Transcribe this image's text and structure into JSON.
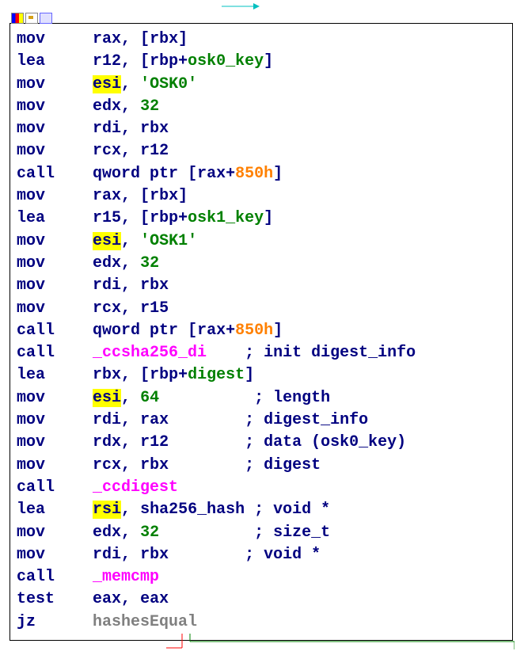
{
  "toolbar": {
    "icons": [
      "color-table-icon",
      "edit-icon",
      "graph-icon"
    ]
  },
  "lines": [
    {
      "m": "mov",
      "pad": "     ",
      "ops": [
        {
          "t": "reg",
          "v": "rax"
        },
        {
          "t": "punct",
          "v": ", ["
        },
        {
          "t": "reg",
          "v": "rbx"
        },
        {
          "t": "punct",
          "v": "]"
        }
      ]
    },
    {
      "m": "lea",
      "pad": "     ",
      "ops": [
        {
          "t": "reg",
          "v": "r12"
        },
        {
          "t": "punct",
          "v": ", ["
        },
        {
          "t": "reg",
          "v": "rbp"
        },
        {
          "t": "punct",
          "v": "+"
        },
        {
          "t": "symbol",
          "v": "osk0_key"
        },
        {
          "t": "punct",
          "v": "]"
        }
      ]
    },
    {
      "m": "mov",
      "pad": "     ",
      "ops": [
        {
          "t": "reg-hl",
          "v": "esi"
        },
        {
          "t": "punct",
          "v": ", "
        },
        {
          "t": "string",
          "v": "'OSK0'"
        }
      ]
    },
    {
      "m": "mov",
      "pad": "     ",
      "ops": [
        {
          "t": "reg",
          "v": "edx"
        },
        {
          "t": "punct",
          "v": ", "
        },
        {
          "t": "number",
          "v": "32"
        }
      ]
    },
    {
      "m": "mov",
      "pad": "     ",
      "ops": [
        {
          "t": "reg",
          "v": "rdi"
        },
        {
          "t": "punct",
          "v": ", "
        },
        {
          "t": "reg",
          "v": "rbx"
        }
      ]
    },
    {
      "m": "mov",
      "pad": "     ",
      "ops": [
        {
          "t": "reg",
          "v": "rcx"
        },
        {
          "t": "punct",
          "v": ", "
        },
        {
          "t": "reg",
          "v": "r12"
        }
      ]
    },
    {
      "m": "call",
      "pad": "    ",
      "ops": [
        {
          "t": "reg",
          "v": "qword ptr "
        },
        {
          "t": "punct",
          "v": "["
        },
        {
          "t": "reg",
          "v": "rax"
        },
        {
          "t": "punct",
          "v": "+"
        },
        {
          "t": "hex-offset",
          "v": "850h"
        },
        {
          "t": "punct",
          "v": "]"
        }
      ]
    },
    {
      "m": "mov",
      "pad": "     ",
      "ops": [
        {
          "t": "reg",
          "v": "rax"
        },
        {
          "t": "punct",
          "v": ", ["
        },
        {
          "t": "reg",
          "v": "rbx"
        },
        {
          "t": "punct",
          "v": "]"
        }
      ]
    },
    {
      "m": "lea",
      "pad": "     ",
      "ops": [
        {
          "t": "reg",
          "v": "r15"
        },
        {
          "t": "punct",
          "v": ", ["
        },
        {
          "t": "reg",
          "v": "rbp"
        },
        {
          "t": "punct",
          "v": "+"
        },
        {
          "t": "symbol",
          "v": "osk1_key"
        },
        {
          "t": "punct",
          "v": "]"
        }
      ]
    },
    {
      "m": "mov",
      "pad": "     ",
      "ops": [
        {
          "t": "reg-hl",
          "v": "esi"
        },
        {
          "t": "punct",
          "v": ", "
        },
        {
          "t": "string",
          "v": "'OSK1'"
        }
      ]
    },
    {
      "m": "mov",
      "pad": "     ",
      "ops": [
        {
          "t": "reg",
          "v": "edx"
        },
        {
          "t": "punct",
          "v": ", "
        },
        {
          "t": "number",
          "v": "32"
        }
      ]
    },
    {
      "m": "mov",
      "pad": "     ",
      "ops": [
        {
          "t": "reg",
          "v": "rdi"
        },
        {
          "t": "punct",
          "v": ", "
        },
        {
          "t": "reg",
          "v": "rbx"
        }
      ]
    },
    {
      "m": "mov",
      "pad": "     ",
      "ops": [
        {
          "t": "reg",
          "v": "rcx"
        },
        {
          "t": "punct",
          "v": ", "
        },
        {
          "t": "reg",
          "v": "r15"
        }
      ]
    },
    {
      "m": "call",
      "pad": "    ",
      "ops": [
        {
          "t": "reg",
          "v": "qword ptr "
        },
        {
          "t": "punct",
          "v": "["
        },
        {
          "t": "reg",
          "v": "rax"
        },
        {
          "t": "punct",
          "v": "+"
        },
        {
          "t": "hex-offset",
          "v": "850h"
        },
        {
          "t": "punct",
          "v": "]"
        }
      ]
    },
    {
      "m": "call",
      "pad": "    ",
      "ops": [
        {
          "t": "func-call",
          "v": "_ccsha256_di"
        },
        {
          "t": "comment",
          "v": "    ; init digest_info"
        }
      ]
    },
    {
      "m": "lea",
      "pad": "     ",
      "ops": [
        {
          "t": "reg",
          "v": "rbx"
        },
        {
          "t": "punct",
          "v": ", ["
        },
        {
          "t": "reg",
          "v": "rbp"
        },
        {
          "t": "punct",
          "v": "+"
        },
        {
          "t": "symbol",
          "v": "digest"
        },
        {
          "t": "punct",
          "v": "]"
        }
      ]
    },
    {
      "m": "mov",
      "pad": "     ",
      "ops": [
        {
          "t": "reg-hl",
          "v": "esi"
        },
        {
          "t": "punct",
          "v": ", "
        },
        {
          "t": "number",
          "v": "64"
        },
        {
          "t": "comment",
          "v": "          ; length"
        }
      ]
    },
    {
      "m": "mov",
      "pad": "     ",
      "ops": [
        {
          "t": "reg",
          "v": "rdi"
        },
        {
          "t": "punct",
          "v": ", "
        },
        {
          "t": "reg",
          "v": "rax"
        },
        {
          "t": "comment",
          "v": "        ; digest_info"
        }
      ]
    },
    {
      "m": "mov",
      "pad": "     ",
      "ops": [
        {
          "t": "reg",
          "v": "rdx"
        },
        {
          "t": "punct",
          "v": ", "
        },
        {
          "t": "reg",
          "v": "r12"
        },
        {
          "t": "comment",
          "v": "        ; data (osk0_key)"
        }
      ]
    },
    {
      "m": "mov",
      "pad": "     ",
      "ops": [
        {
          "t": "reg",
          "v": "rcx"
        },
        {
          "t": "punct",
          "v": ", "
        },
        {
          "t": "reg",
          "v": "rbx"
        },
        {
          "t": "comment",
          "v": "        ; digest"
        }
      ]
    },
    {
      "m": "call",
      "pad": "    ",
      "ops": [
        {
          "t": "func-call",
          "v": "_ccdigest"
        }
      ]
    },
    {
      "m": "lea",
      "pad": "     ",
      "ops": [
        {
          "t": "reg-hl",
          "v": "rsi"
        },
        {
          "t": "punct",
          "v": ", "
        },
        {
          "t": "reg",
          "v": "sha256_hash"
        },
        {
          "t": "comment",
          "v": " ; void *"
        }
      ]
    },
    {
      "m": "mov",
      "pad": "     ",
      "ops": [
        {
          "t": "reg",
          "v": "edx"
        },
        {
          "t": "punct",
          "v": ", "
        },
        {
          "t": "number",
          "v": "32"
        },
        {
          "t": "comment",
          "v": "          ; size_t"
        }
      ]
    },
    {
      "m": "mov",
      "pad": "     ",
      "ops": [
        {
          "t": "reg",
          "v": "rdi"
        },
        {
          "t": "punct",
          "v": ", "
        },
        {
          "t": "reg",
          "v": "rbx"
        },
        {
          "t": "comment",
          "v": "        ; void *"
        }
      ]
    },
    {
      "m": "call",
      "pad": "    ",
      "ops": [
        {
          "t": "func-call",
          "v": "_memcmp"
        }
      ]
    },
    {
      "m": "test",
      "pad": "    ",
      "ops": [
        {
          "t": "reg",
          "v": "eax"
        },
        {
          "t": "punct",
          "v": ", "
        },
        {
          "t": "reg",
          "v": "eax"
        }
      ]
    },
    {
      "m": "jz",
      "pad": "      ",
      "ops": [
        {
          "t": "label",
          "v": "hashesEqual"
        }
      ]
    }
  ]
}
